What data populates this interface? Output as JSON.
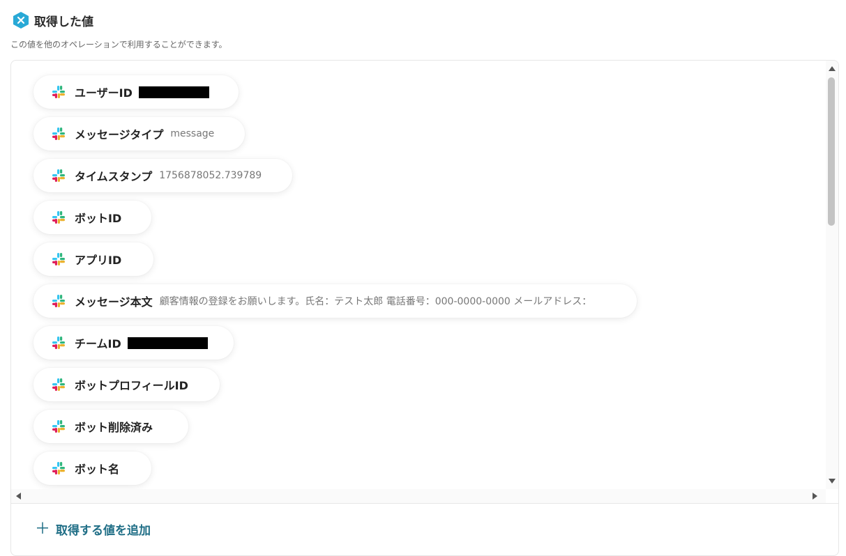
{
  "header": {
    "title": "取得した値",
    "subtitle": "この値を他のオペレーションで利用することができます。",
    "icon": "hexagon-x-icon",
    "accent": "#29a9d6"
  },
  "items": [
    {
      "label": "ユーザーID",
      "value": "",
      "redacted": true,
      "icon": "slack-icon"
    },
    {
      "label": "メッセージタイプ",
      "value": "message",
      "icon": "slack-icon"
    },
    {
      "label": "タイムスタンプ",
      "value": "1756878052.739789",
      "icon": "slack-icon"
    },
    {
      "label": "ボットID",
      "value": "",
      "icon": "slack-icon"
    },
    {
      "label": "アプリID",
      "value": "",
      "icon": "slack-icon"
    },
    {
      "label": "メッセージ本文",
      "value": "顧客情報の登録をお願いします。氏名：テスト太郎 電話番号：000-0000-0000 メールアドレス：",
      "icon": "slack-icon"
    },
    {
      "label": "チームID",
      "value": "",
      "redacted": true,
      "icon": "slack-icon"
    },
    {
      "label": "ボットプロフィールID",
      "value": "",
      "icon": "slack-icon"
    },
    {
      "label": "ボット削除済み",
      "value": "",
      "icon": "slack-icon"
    },
    {
      "label": "ボット名",
      "value": "",
      "icon": "slack-icon"
    }
  ],
  "footer": {
    "add_label": "取得する値を追加",
    "add_color": "#1f6e86"
  }
}
